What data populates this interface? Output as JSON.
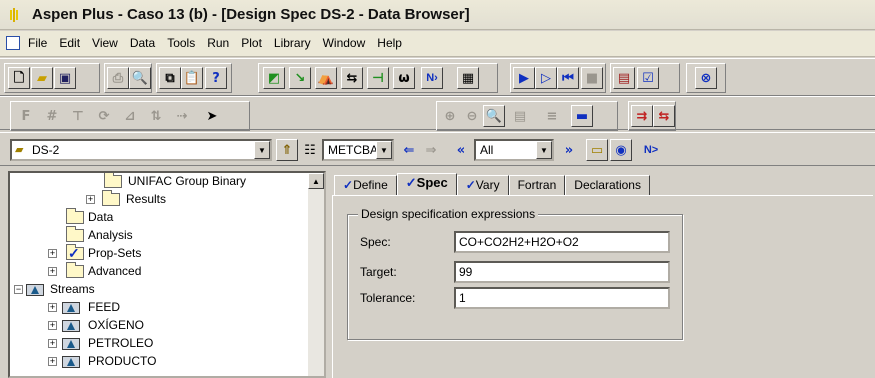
{
  "window": {
    "title": "Aspen Plus - Caso 13 (b) - [Design Spec DS-2 - Data Browser]"
  },
  "menu": [
    "File",
    "Edit",
    "View",
    "Data",
    "Tools",
    "Run",
    "Plot",
    "Library",
    "Window",
    "Help"
  ],
  "nav": {
    "object_combo": "DS-2",
    "units_combo": "METCBAR",
    "filter_combo": "All",
    "next_button": "N>"
  },
  "tree": {
    "items": [
      {
        "label": "UNIFAC Group Binary"
      },
      {
        "label": "Results"
      },
      {
        "label": "Data"
      },
      {
        "label": "Analysis"
      },
      {
        "label": "Prop-Sets"
      },
      {
        "label": "Advanced"
      },
      {
        "label": "Streams"
      },
      {
        "label": "FEED"
      },
      {
        "label": "OXÍGENO"
      },
      {
        "label": "PETROLEO"
      },
      {
        "label": "PRODUCTO"
      }
    ]
  },
  "tabs": [
    {
      "label": "Define",
      "checked": true
    },
    {
      "label": "Spec",
      "checked": true
    },
    {
      "label": "Vary",
      "checked": true
    },
    {
      "label": "Fortran",
      "checked": false
    },
    {
      "label": "Declarations",
      "checked": false
    }
  ],
  "design_spec": {
    "group_title": "Design specification expressions",
    "spec_label": "Spec:",
    "spec_value": "CO+CO2H2+H2O+O2",
    "target_label": "Target:",
    "target_value": "99",
    "tolerance_label": "Tolerance:",
    "tolerance_value": "1"
  }
}
